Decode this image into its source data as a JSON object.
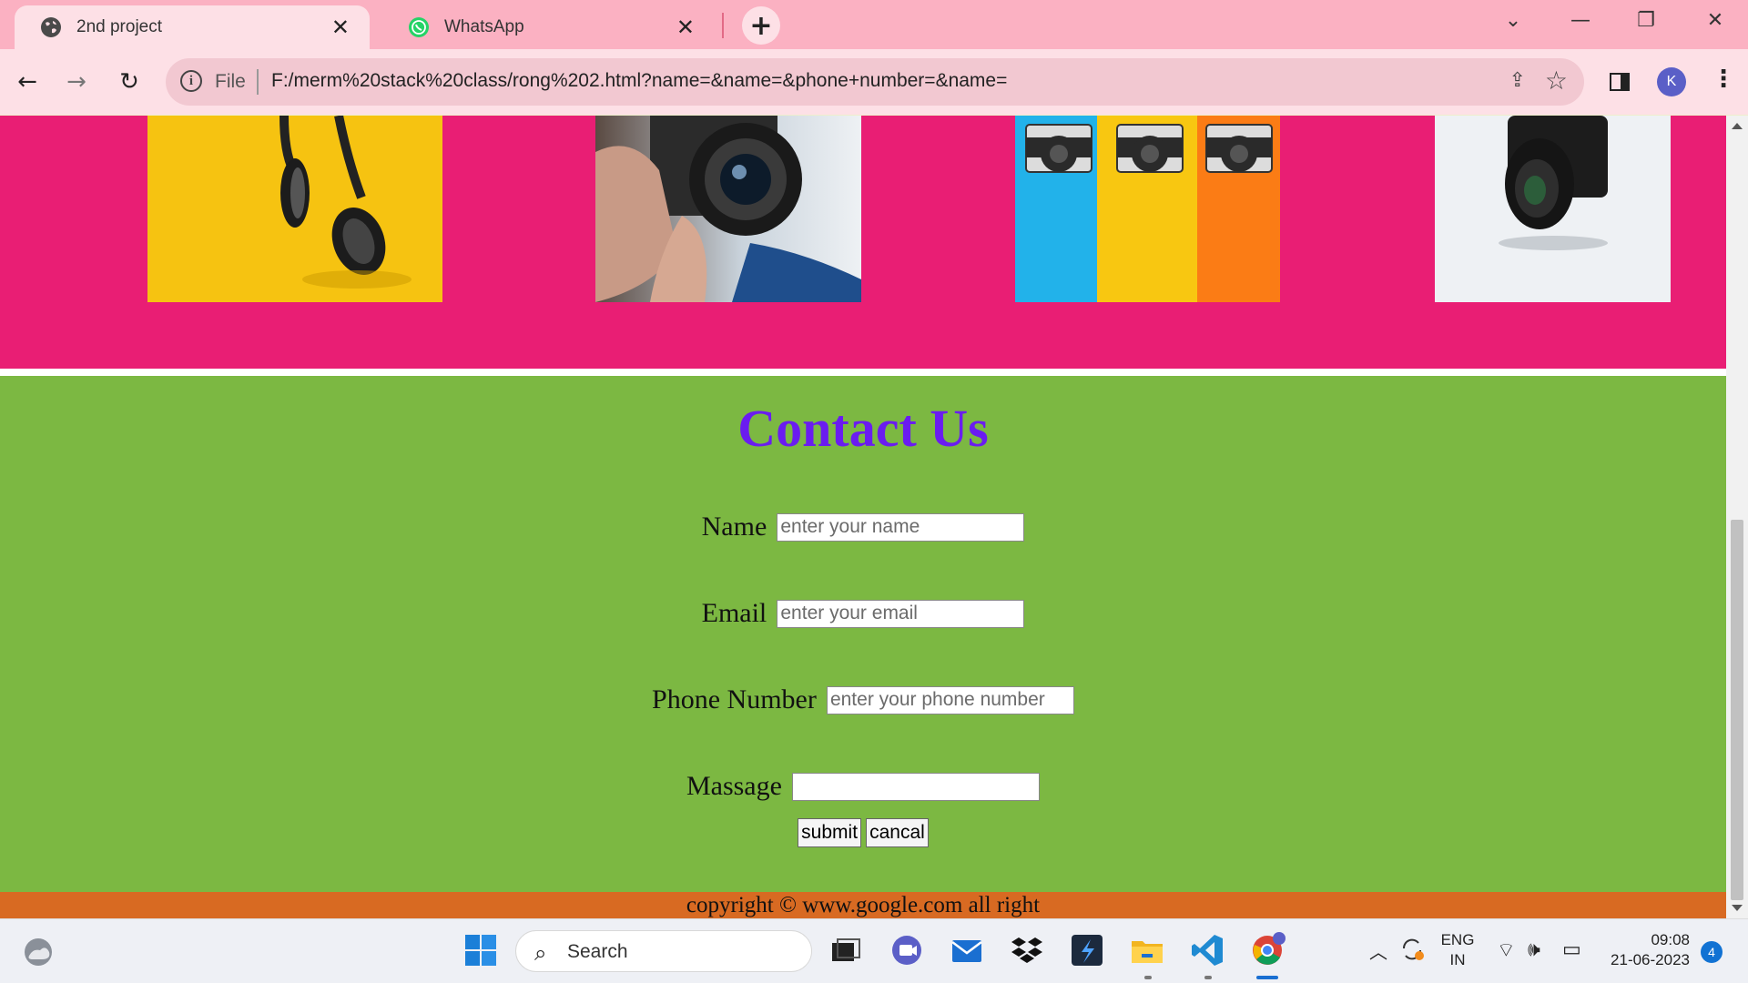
{
  "browser": {
    "tabs": [
      {
        "title": "2nd project",
        "active": true,
        "favicon": "globe-icon"
      },
      {
        "title": "WhatsApp",
        "active": false,
        "favicon": "whatsapp-icon"
      }
    ],
    "address": {
      "scheme_label": "File",
      "url": "F:/merm%20stack%20class/rong%202.html?name=&name=&phone+number=&name="
    },
    "profile_initial": "K"
  },
  "page": {
    "gallery_images": [
      {
        "subject": "headphones-on-yellow"
      },
      {
        "subject": "hands-holding-camera"
      },
      {
        "subject": "three-cameras-colorful"
      },
      {
        "subject": "black-camera-white"
      }
    ],
    "contact": {
      "heading": "Contact Us",
      "fields": [
        {
          "label": "Name",
          "placeholder": "enter your name",
          "value": ""
        },
        {
          "label": "Email",
          "placeholder": "enter your email",
          "value": ""
        },
        {
          "label": "Phone Number",
          "placeholder": "enter your phone number",
          "value": ""
        },
        {
          "label": "Massage",
          "placeholder": "",
          "value": ""
        }
      ],
      "submit_label": "submit",
      "cancel_label": "cancal"
    },
    "footer": "copyright © www.google.com all right"
  },
  "taskbar": {
    "search_label": "Search",
    "lang_line1": "ENG",
    "lang_line2": "IN",
    "time": "09:08",
    "date": "21-06-2023",
    "notification_count": "4"
  },
  "colors": {
    "tabstrip": "#fbb1c2",
    "gallery_bg": "#e91e74",
    "contact_bg": "#7cb842",
    "heading": "#6a1cf0",
    "footer_bg": "#d86a22"
  }
}
